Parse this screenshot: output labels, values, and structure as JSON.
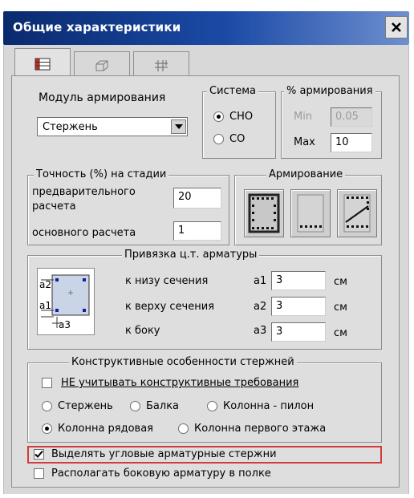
{
  "window": {
    "title": "Общие характеристики",
    "close_glyph": "✕"
  },
  "tabs": [
    {
      "icon": "table-icon",
      "active": true
    },
    {
      "icon": "cube-outline-icon",
      "active": false
    },
    {
      "icon": "grid-rebar-icon",
      "active": false
    }
  ],
  "module": {
    "label": "Модуль армирования",
    "selected": "Стержень"
  },
  "system": {
    "legend": "Система",
    "options": [
      {
        "label": "СНО",
        "selected": true
      },
      {
        "label": "СО",
        "selected": false
      }
    ]
  },
  "percent": {
    "legend": "% армирования",
    "min_label": "Min",
    "min_value": "0.05",
    "max_label": "Max",
    "max_value": "10"
  },
  "accuracy": {
    "legend": "Точность (%) на стадии",
    "prelim_label_1": "предварительного",
    "prelim_label_2": "расчета",
    "prelim_value": "20",
    "main_label": "основного расчета",
    "main_value": "1"
  },
  "reinforcement": {
    "legend": "Армирование"
  },
  "binding": {
    "legend": "Привязка  ц.т. арматуры",
    "diagram_labels": {
      "a2": "a2",
      "a1": "a1",
      "a3": "a3"
    },
    "rows": [
      {
        "label": "к низу сечения",
        "param": "a1",
        "value": "3",
        "unit": "см"
      },
      {
        "label": "к верху сечения",
        "param": "a2",
        "value": "3",
        "unit": "см"
      },
      {
        "label": "к боку",
        "param": "a3",
        "value": "3",
        "unit": "см"
      }
    ]
  },
  "features": {
    "legend": "Конструктивные особенности стержней",
    "ignore_label": "НЕ учитывать конструктивные требования",
    "ignore_checked": false,
    "types_row1": [
      {
        "label": "Стержень",
        "selected": false
      },
      {
        "label": "Балка",
        "selected": false
      },
      {
        "label": "Колонна - пилон",
        "selected": false
      }
    ],
    "types_row2": [
      {
        "label": "Колонна рядовая",
        "selected": true
      },
      {
        "label": "Колонна первого этажа",
        "selected": false
      }
    ]
  },
  "options": {
    "corner_label": "Выделять угловые арматурные стержни",
    "corner_checked": true,
    "side_label": "Располагать боковую арматуру в полке",
    "side_checked": false
  },
  "colors": {
    "title_bar": "#1b4aa6",
    "highlight": "#d23c3c",
    "dialog_bg": "#d8d8d8"
  }
}
